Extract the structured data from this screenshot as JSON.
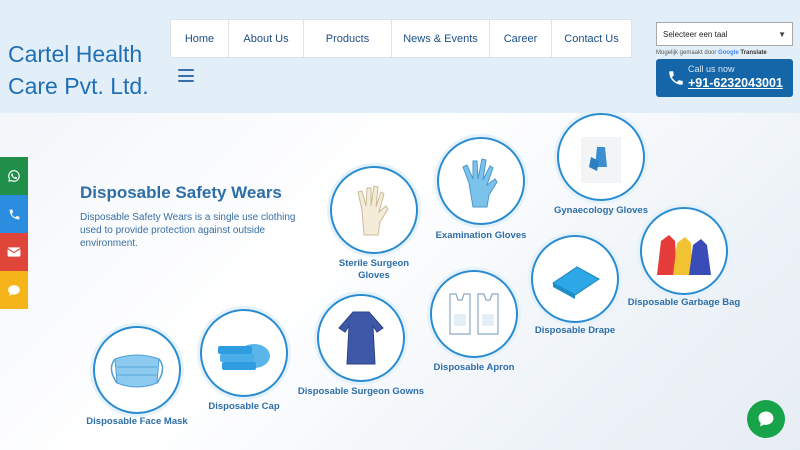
{
  "header": {
    "logo_text": "Cartel Health Care Pvt. Ltd.",
    "nav": [
      {
        "label": "Home"
      },
      {
        "label": "About Us"
      },
      {
        "label": "Products"
      },
      {
        "label": "News & Events"
      },
      {
        "label": "Career"
      },
      {
        "label": "Contact Us"
      }
    ],
    "language_select": "Selecteer een taal",
    "powered_by": "Mogelijk gemaakt door",
    "powered_google": "Google",
    "powered_translate": "Translate",
    "call_label": "Call us now",
    "call_number": "+91-6232043001"
  },
  "banner": {
    "title": "Disposable Safety Wears",
    "description": "Disposable Safety Wears is a single use clothing used to provide protection against outside environment.",
    "products": [
      {
        "label": "Sterile Surgeon Gloves"
      },
      {
        "label": "Examination Gloves"
      },
      {
        "label": "Gynaecology Gloves"
      },
      {
        "label": "Disposable Garbage Bag"
      },
      {
        "label": "Disposable Drape"
      },
      {
        "label": "Disposable Apron"
      },
      {
        "label": "Disposable Surgeon Gowns"
      },
      {
        "label": "Disposable Cap"
      },
      {
        "label": "Disposable Face Mask"
      }
    ]
  },
  "colors": {
    "brand_blue": "#1f6fb5",
    "call_bg": "#1466a8",
    "whatsapp": "#1f8f4a",
    "phone": "#2b8de0",
    "email": "#e0453a",
    "sms": "#f4b41a",
    "chat": "#16a34a"
  },
  "icons": {
    "side": [
      "whatsapp-icon",
      "phone-icon",
      "envelope-icon",
      "speech-bubble-icon"
    ],
    "chat": "chat-bubble-icon",
    "call": "phone-icon"
  }
}
